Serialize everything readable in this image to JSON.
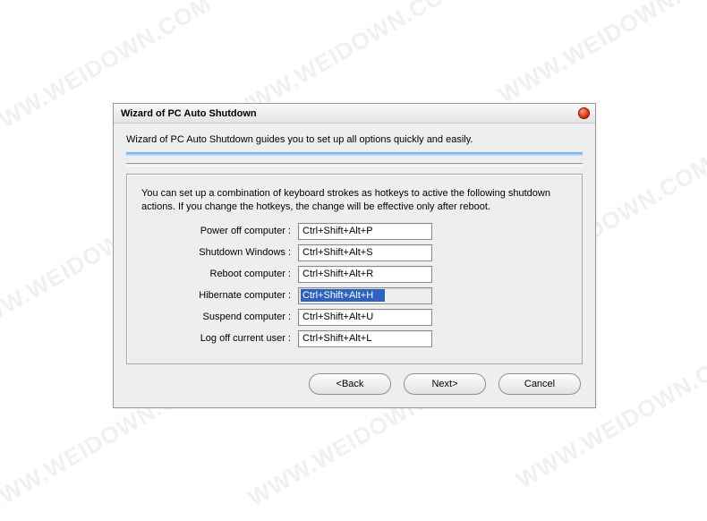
{
  "watermark": "WWW.WEIDOWN.COM",
  "dialog": {
    "title": "Wizard of PC Auto Shutdown",
    "subtitle": "Wizard of PC Auto Shutdown guides you to set up all options quickly and easily.",
    "description": "You can set up a combination of keyboard strokes as hotkeys to active the following shutdown actions. If you change the hotkeys, the change will be effective only after reboot.",
    "hotkeys": [
      {
        "label": "Power off computer :",
        "value": "Ctrl+Shift+Alt+P",
        "selected": false
      },
      {
        "label": "Shutdown Windows :",
        "value": "Ctrl+Shift+Alt+S",
        "selected": false
      },
      {
        "label": "Reboot computer :",
        "value": "Ctrl+Shift+Alt+R",
        "selected": false
      },
      {
        "label": "Hibernate computer :",
        "value": "Ctrl+Shift+Alt+H",
        "selected": true
      },
      {
        "label": "Suspend computer :",
        "value": "Ctrl+Shift+Alt+U",
        "selected": false
      },
      {
        "label": "Log off current user :",
        "value": "Ctrl+Shift+Alt+L",
        "selected": false
      }
    ],
    "buttons": {
      "back": "<Back",
      "next": "Next>",
      "cancel": "Cancel"
    }
  }
}
